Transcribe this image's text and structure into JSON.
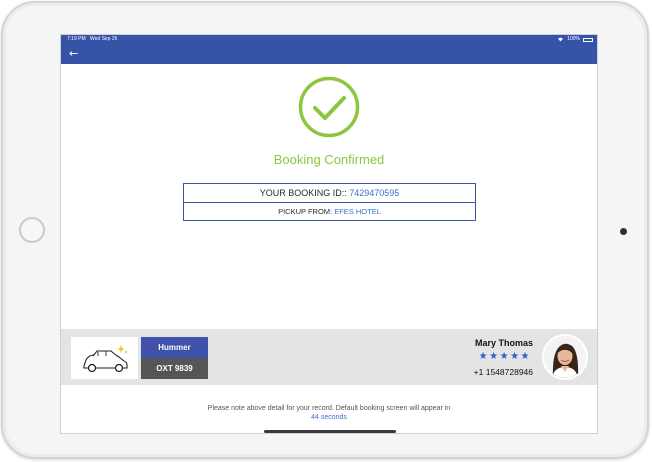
{
  "status_bar": {
    "time": "7:19 PM",
    "date": "Wed Sep 26",
    "battery": "100%"
  },
  "confirmation": {
    "title": "Booking Confirmed",
    "booking_id_label": "YOUR BOOKING ID:: ",
    "booking_id": "7429470595",
    "pickup_label": "PICKUP FROM: ",
    "pickup_location": "EFES HOTEL"
  },
  "vehicle": {
    "name": "Hummer",
    "plate": "OXT 9839"
  },
  "driver": {
    "name": "Mary Thomas",
    "rating": 5,
    "rating_stars": "★★★★★",
    "phone": "+1 1548728946"
  },
  "notice": {
    "message": "Please note above detail for your record. Default booking screen will appear in",
    "countdown": "44 seconds"
  },
  "colors": {
    "header": "#3554a8",
    "success": "#8cc63f",
    "link": "#3b6fcf",
    "vehicle_name_bg": "#3f51a8",
    "plate_bg": "#555555"
  },
  "icons": [
    "back-arrow-icon",
    "check-circle-icon",
    "car-icon",
    "wifi-icon",
    "battery-icon"
  ]
}
